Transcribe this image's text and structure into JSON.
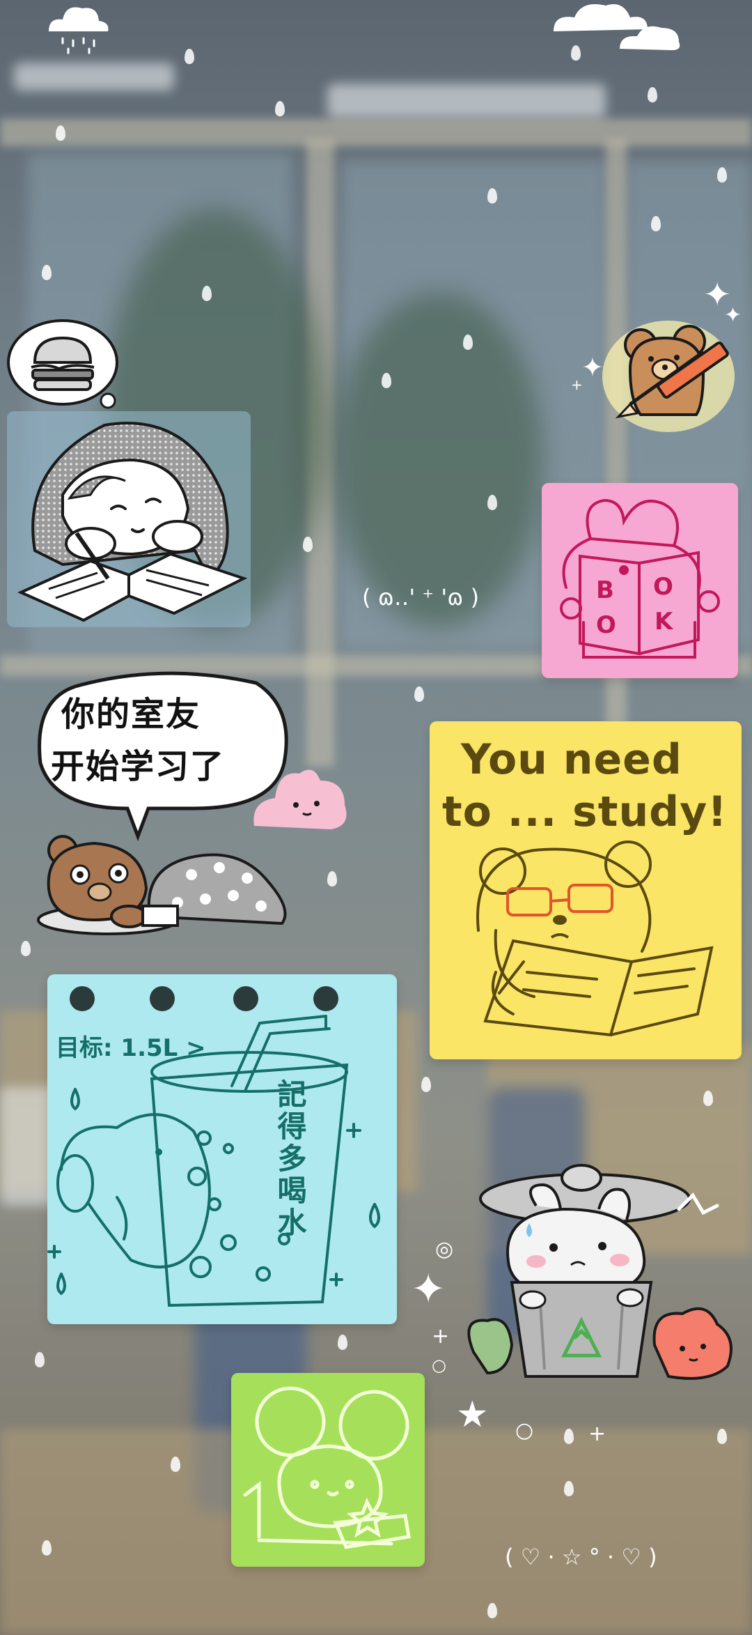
{
  "speech_bubble": {
    "line1": "你的室友",
    "line2": "开始学习了"
  },
  "study_note": {
    "line1": "You need",
    "line2": "to ... study!"
  },
  "book_note": {
    "letters": [
      "B",
      "O",
      "O",
      "K"
    ]
  },
  "water_note": {
    "goal": "目标: 1.5L >",
    "reminder": "記得多喝水"
  },
  "kaomoji": {
    "upper": "( ɷ‥' ⁺ 'ɷ )",
    "lower": "( ♡ · ☆ ° · ♡ )"
  },
  "icons": [
    "cloud-icon",
    "burger-icon",
    "pencil-icon",
    "recycle-icon",
    "sparkle-icon"
  ],
  "colors": {
    "pink_note": "#f7a8d2",
    "yellow_note": "#fbe566",
    "cyan_note": "#aee9ef",
    "green_note": "#a6e05a",
    "sticker_outline": "#1a1a1a"
  }
}
